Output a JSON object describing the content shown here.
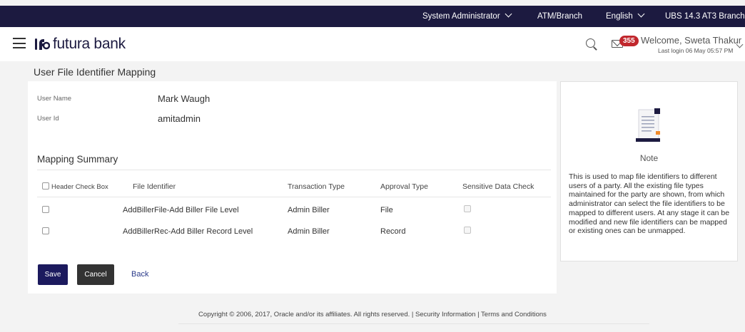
{
  "topbar": {
    "role": "System Administrator",
    "atm_branch": "ATM/Branch",
    "language": "English",
    "version": "UBS 14.3 AT3 Branch"
  },
  "header": {
    "brand": "futura bank",
    "mail_count": "355",
    "welcome": "Welcome, Sweta Thakur",
    "last_login": "Last login 06 May 05:57 PM"
  },
  "page": {
    "title": "User File Identifier Mapping"
  },
  "user": {
    "name_label": "User Name",
    "name_value": "Mark Waugh",
    "id_label": "User Id",
    "id_value": "amitadmin"
  },
  "mapping": {
    "title": "Mapping Summary",
    "columns": [
      "Header Check Box",
      "File Identifier",
      "Transaction Type",
      "Approval Type",
      "Sensitive Data Check"
    ],
    "rows": [
      {
        "file_identifier": "AddBillerFile-Add Biller File Level",
        "transaction_type": "Admin Biller",
        "approval_type": "File"
      },
      {
        "file_identifier": "AddBillerRec-Add Biller Record Level",
        "transaction_type": "Admin Biller",
        "approval_type": "Record"
      }
    ]
  },
  "actions": {
    "save": "Save",
    "cancel": "Cancel",
    "back": "Back"
  },
  "note": {
    "title": "Note",
    "text": "This is used to map file identifiers to different users of a party. All the existing file types maintained for the party are shown, from which administrator can select the file identifiers to be mapped to different users. At any stage it can be modified and new file identifiers can be mapped or existing ones can be unmapped."
  },
  "footer": {
    "text": "Copyright © 2006, 2017, Oracle and/or its affiliates. All rights reserved. | Security Information | Terms and Conditions"
  },
  "colors": {
    "topbar": "#1c1a40",
    "primary_button": "#1c1a5e",
    "badge": "#c1272d"
  }
}
